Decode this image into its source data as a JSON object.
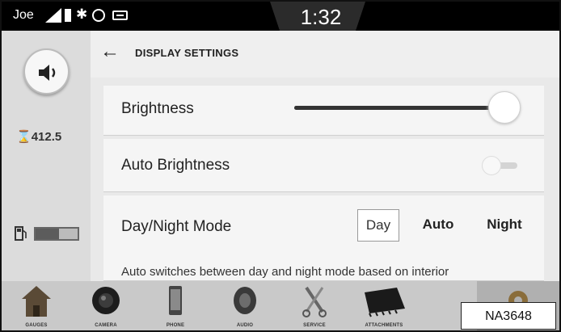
{
  "statusbar": {
    "user": "Joe",
    "time": "1:32"
  },
  "sidebar": {
    "odometer": "412.5",
    "fuel_level": 0.55
  },
  "header": {
    "title": "DISPLAY SETTINGS"
  },
  "settings": {
    "brightness": {
      "label": "Brightness",
      "value": 0.95
    },
    "auto_brightness": {
      "label": "Auto Brightness",
      "enabled": false
    },
    "day_night": {
      "label": "Day/Night Mode",
      "options": [
        "Day",
        "Auto",
        "Night"
      ],
      "selected": "Day",
      "description": "Auto switches between day and night mode based on interior"
    }
  },
  "nav": [
    {
      "label": "GAUGES",
      "icon": "house-icon"
    },
    {
      "label": "CAMERA",
      "icon": "camera-icon"
    },
    {
      "label": "PHONE",
      "icon": "phone-icon"
    },
    {
      "label": "AUDIO",
      "icon": "speaker-icon"
    },
    {
      "label": "SERVICE",
      "icon": "tools-icon"
    },
    {
      "label": "ATTACHMENTS",
      "icon": "attachment-icon"
    },
    {
      "label": "",
      "icon": "settings-icon"
    }
  ],
  "figure_code": "NA3648"
}
